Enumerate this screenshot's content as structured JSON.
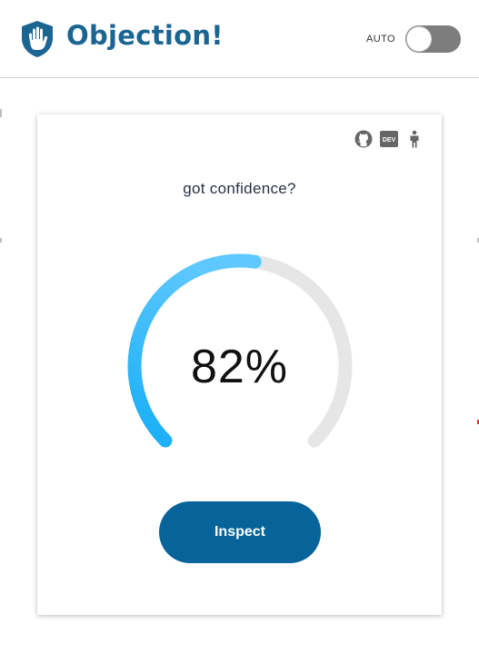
{
  "header": {
    "title": "Objection!",
    "auto_label": "AUTO",
    "auto_enabled": false
  },
  "card": {
    "icons": [
      "github-icon",
      "dev-icon",
      "accessibility-icon"
    ],
    "dev_badge": "DEV",
    "question": "got confidence?",
    "confidence_value": 82,
    "confidence_text": "82%",
    "button_label": "Inspect"
  },
  "colors": {
    "brand": "#1b6592",
    "button": "#06649a",
    "gauge_start": "#18aef5",
    "gauge_end": "#5ec8ff",
    "gauge_track": "#e6e6e6",
    "toggle_off": "#7d7d7d"
  }
}
